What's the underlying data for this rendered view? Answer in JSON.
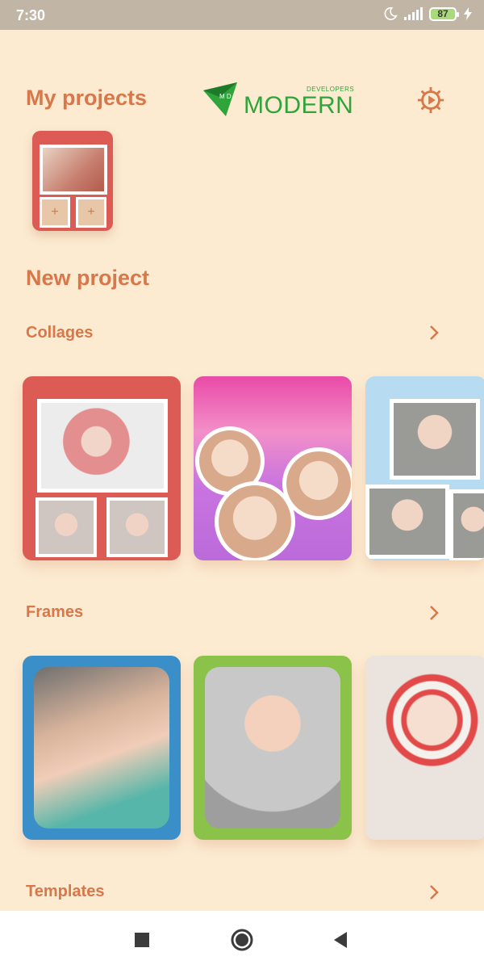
{
  "status_bar": {
    "time": "7:30",
    "battery": "87"
  },
  "header": {
    "my_projects_title": "My projects",
    "logo_text": "MODERN",
    "logo_subtext": "DEVELOPERS",
    "logo_mark": "M D"
  },
  "projects": [
    {
      "kind": "collage",
      "slot_label": "+"
    }
  ],
  "new_project": {
    "title": "New project",
    "sections": [
      {
        "title": "Collages"
      },
      {
        "title": "Frames"
      },
      {
        "title": "Templates"
      }
    ]
  },
  "icons": {
    "settings": "gear-icon",
    "chevron": "chevron-right-icon",
    "nav_recents": "square-icon",
    "nav_home": "circle-icon",
    "nav_back": "back-triangle-icon"
  },
  "colors": {
    "accent": "#d8774a",
    "background": "#fcebd1",
    "logo_green": "#2fa43b",
    "status_bar": "#c1b6a5"
  }
}
